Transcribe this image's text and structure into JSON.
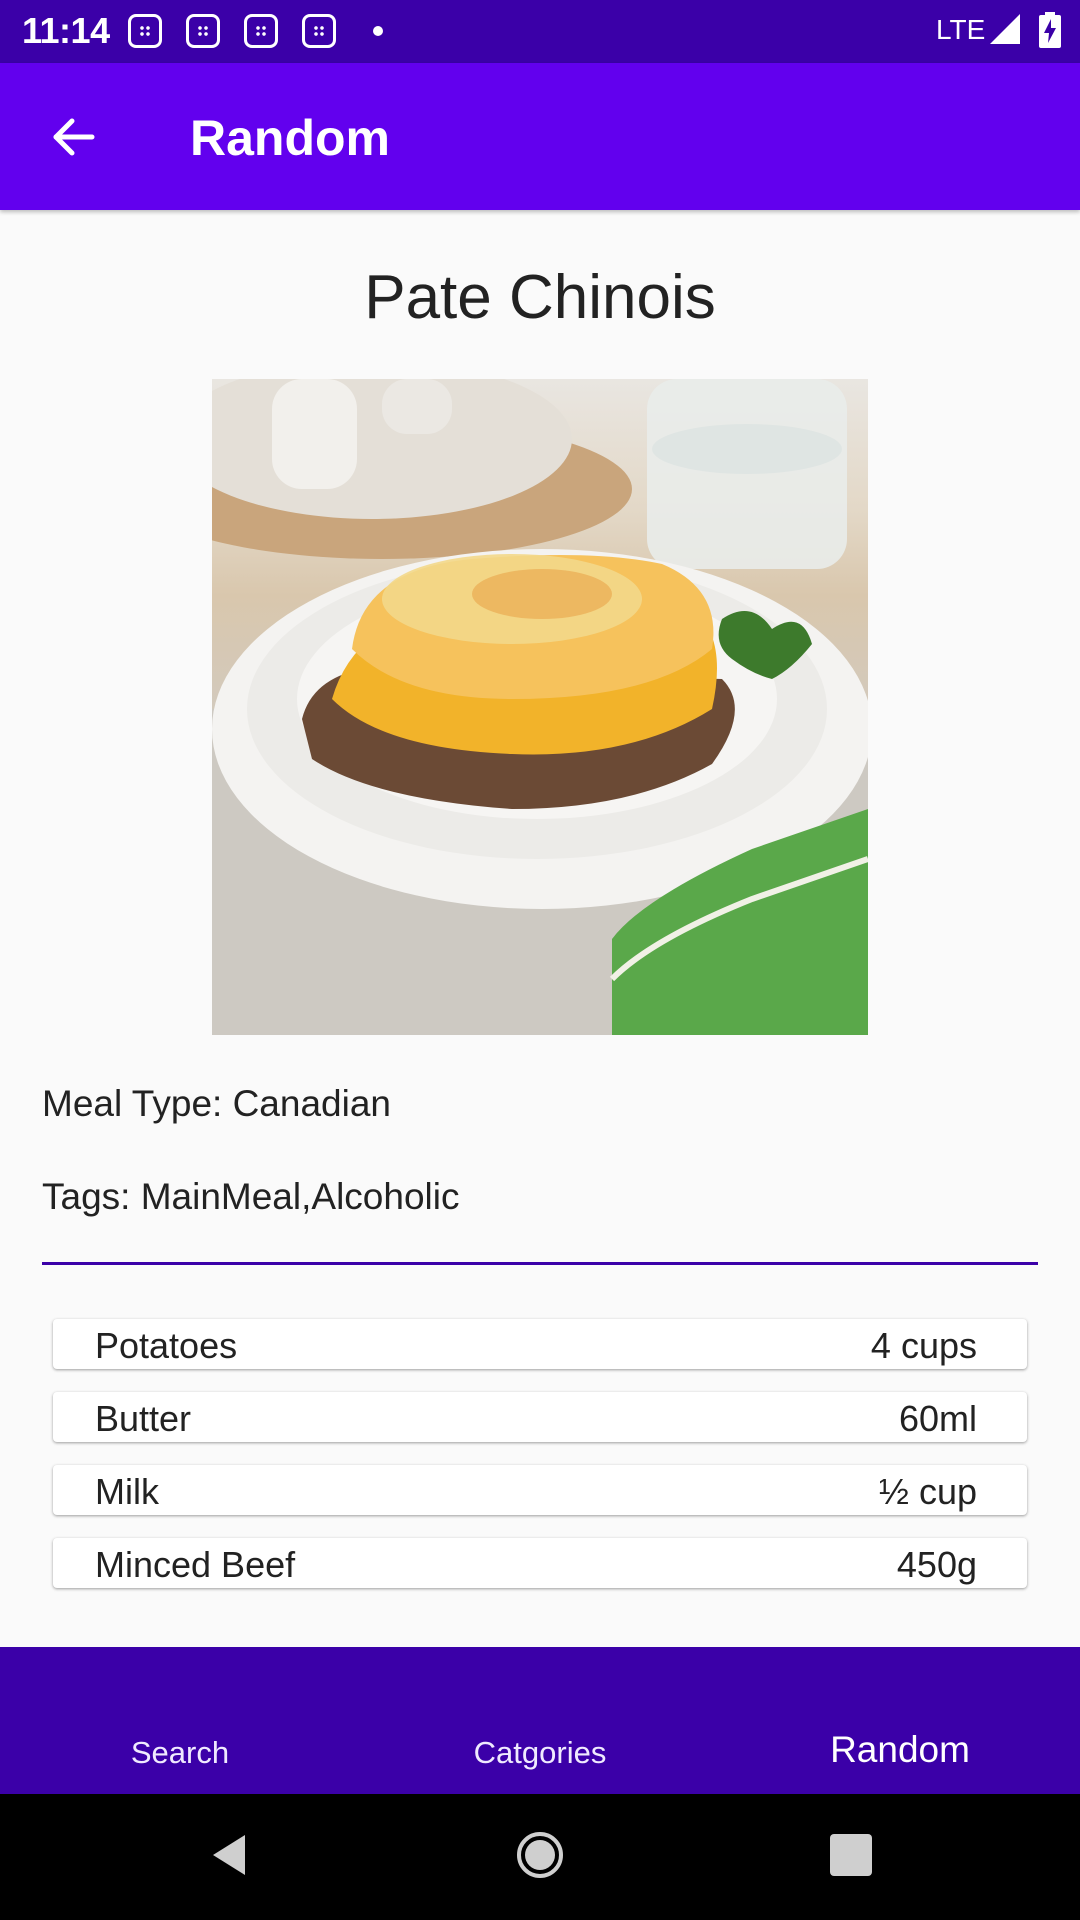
{
  "status_bar": {
    "time": "11:14",
    "network": "LTE",
    "notification_icons": [
      "calendar-icon",
      "calendar-icon",
      "calendar-icon",
      "calendar-icon"
    ]
  },
  "app_bar": {
    "title": "Random",
    "back_icon": "arrow-back-icon",
    "background": "#6200ee"
  },
  "meal": {
    "name": "Pate Chinois",
    "type_line": "Meal Type: Canadian",
    "tags_line": "Tags: MainMeal,Alcoholic",
    "ingredients": [
      {
        "name": "Potatoes",
        "measure": "4 cups"
      },
      {
        "name": "Butter",
        "measure": "60ml"
      },
      {
        "name": "Milk",
        "measure": "½ cup"
      },
      {
        "name": "Minced Beef",
        "measure": "450g"
      }
    ]
  },
  "bottom_nav": {
    "items": [
      {
        "label": "Search",
        "active": false
      },
      {
        "label": "Catgories",
        "active": false
      },
      {
        "label": "Random",
        "active": true
      }
    ],
    "background": "#3b00a8"
  },
  "colors": {
    "status_bar": "#3b00a8",
    "accent": "#6200ee",
    "divider": "#3b00a8"
  }
}
